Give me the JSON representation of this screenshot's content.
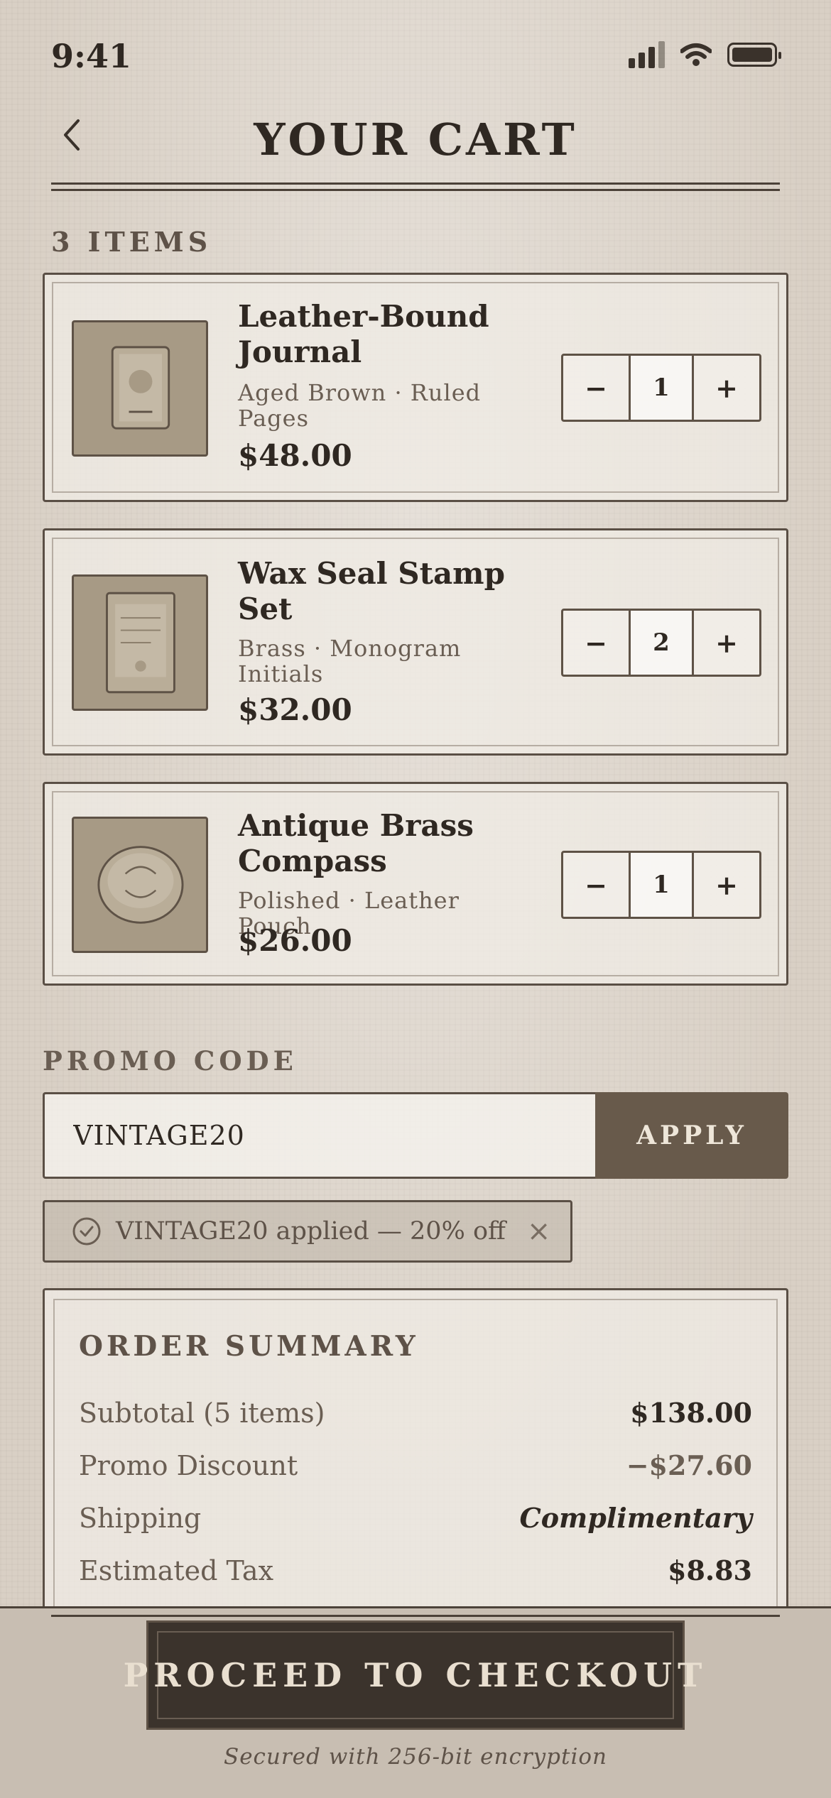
{
  "status_bar": {
    "time": "9:41"
  },
  "header": {
    "title": "YOUR CART",
    "back_icon": "chevron-left-icon"
  },
  "cart": {
    "count_label": "3 ITEMS",
    "items": [
      {
        "name": "Leather-Bound Journal",
        "variant": "Aged Brown · Ruled Pages",
        "price": "$48.00",
        "quantity": "1",
        "icon": "journal-icon"
      },
      {
        "name": "Wax Seal Stamp Set",
        "variant": "Brass · Monogram Initials",
        "price": "$32.00",
        "quantity": "2",
        "icon": "wax-seal-icon"
      },
      {
        "name": "Antique Brass Compass",
        "variant": "Polished · Leather Pouch",
        "price": "$26.00",
        "quantity": "1",
        "icon": "compass-icon"
      }
    ],
    "decrement_label": "−",
    "increment_label": "+"
  },
  "promo": {
    "label": "PROMO CODE",
    "value": "VINTAGE20",
    "apply_label": "APPLY",
    "applied_text": "VINTAGE20 applied — 20% off",
    "remove_label": "×"
  },
  "summary": {
    "title": "ORDER SUMMARY",
    "rows": [
      {
        "label": "Subtotal (5 items)",
        "value": "$138.00"
      },
      {
        "label": "Promo Discount",
        "value": "−$27.60"
      },
      {
        "label": "Shipping",
        "value": "Complimentary"
      },
      {
        "label": "Estimated Tax",
        "value": "$8.83"
      }
    ]
  },
  "checkout": {
    "button_label": "PROCEED TO CHECKOUT",
    "security_note": "Secured with 256-bit encryption"
  },
  "colors": {
    "background": "#d9d0c5",
    "ink": "#2f2822",
    "accent_button": "#685a4b",
    "checkout_button": "#3b332c"
  }
}
